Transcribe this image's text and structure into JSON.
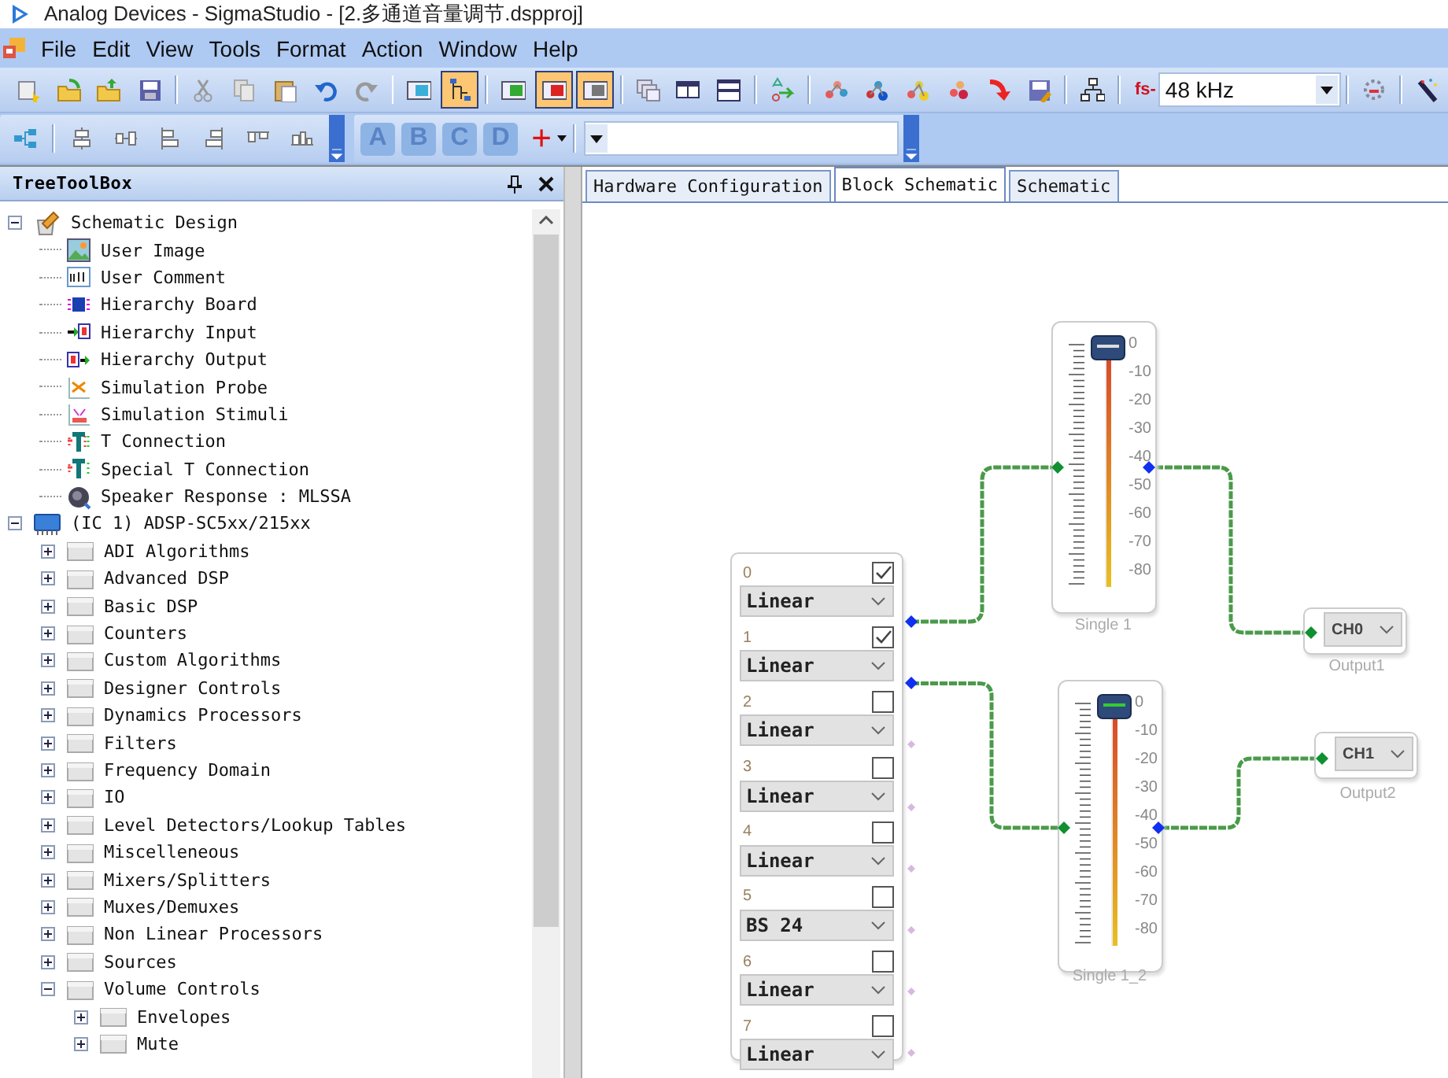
{
  "window": {
    "title": "Analog Devices - SigmaStudio - [2.多通道音量调节.dspproj]"
  },
  "menu": [
    "File",
    "Edit",
    "View",
    "Tools",
    "Format",
    "Action",
    "Window",
    "Help"
  ],
  "toolbar": {
    "buttons": [
      {
        "pressed": false
      },
      {
        "pressed": false
      },
      {
        "pressed": false
      },
      {
        "pressed": false
      },
      {
        "pressed": false
      },
      {
        "pressed": false
      },
      {
        "pressed": false
      },
      {
        "pressed": false
      },
      {
        "pressed": false
      },
      {
        "pressed": false
      },
      {
        "pressed": true
      },
      {
        "pressed": false
      },
      {
        "pressed": true
      },
      {
        "pressed": true
      },
      {
        "pressed": false
      },
      {
        "pressed": false
      },
      {
        "pressed": false
      },
      {
        "pressed": false
      },
      {
        "pressed": false
      },
      {
        "pressed": false
      },
      {
        "pressed": false
      },
      {
        "pressed": false
      },
      {
        "pressed": false
      },
      {
        "pressed": false
      },
      {
        "pressed": false
      }
    ],
    "fs_label": "fs-",
    "sample_rate": "48 kHz"
  },
  "toolbar2": {
    "letters": [
      "A",
      "B",
      "C",
      "D"
    ],
    "add": "+"
  },
  "panel": {
    "title": "TreeToolBox",
    "tree": [
      {
        "label": "Schematic Design",
        "kind": "design",
        "expanded": true,
        "children": [
          {
            "label": "User Image",
            "kind": "tool"
          },
          {
            "label": "User Comment",
            "kind": "tool"
          },
          {
            "label": "Hierarchy Board",
            "kind": "tool"
          },
          {
            "label": "Hierarchy Input",
            "kind": "tool"
          },
          {
            "label": "Hierarchy Output",
            "kind": "tool"
          },
          {
            "label": "Simulation Probe",
            "kind": "tool"
          },
          {
            "label": "Simulation Stimuli",
            "kind": "tool"
          },
          {
            "label": "T Connection",
            "kind": "tool"
          },
          {
            "label": "Special T Connection",
            "kind": "tool"
          },
          {
            "label": "Speaker Response : MLSSA",
            "kind": "tool"
          }
        ]
      },
      {
        "label": "(IC 1) ADSP-SC5xx/215xx",
        "kind": "chip",
        "expanded": true,
        "children": [
          {
            "label": "ADI Algorithms",
            "kind": "folder",
            "expanded": false
          },
          {
            "label": "Advanced DSP",
            "kind": "folder",
            "expanded": false
          },
          {
            "label": "Basic DSP",
            "kind": "folder",
            "expanded": false
          },
          {
            "label": "Counters",
            "kind": "folder",
            "expanded": false
          },
          {
            "label": "Custom Algorithms",
            "kind": "folder",
            "expanded": false
          },
          {
            "label": "Designer Controls",
            "kind": "folder",
            "expanded": false
          },
          {
            "label": "Dynamics Processors",
            "kind": "folder",
            "expanded": false
          },
          {
            "label": "Filters",
            "kind": "folder",
            "expanded": false
          },
          {
            "label": "Frequency Domain",
            "kind": "folder",
            "expanded": false
          },
          {
            "label": "IO",
            "kind": "folder",
            "expanded": false
          },
          {
            "label": "Level Detectors/Lookup Tables",
            "kind": "folder",
            "expanded": false
          },
          {
            "label": "Miscelleneous",
            "kind": "folder",
            "expanded": false
          },
          {
            "label": "Mixers/Splitters",
            "kind": "folder",
            "expanded": false
          },
          {
            "label": "Muxes/Demuxes",
            "kind": "folder",
            "expanded": false
          },
          {
            "label": "Non Linear Processors",
            "kind": "folder",
            "expanded": false
          },
          {
            "label": "Sources",
            "kind": "folder",
            "expanded": false
          },
          {
            "label": "Volume Controls",
            "kind": "folder",
            "expanded": true,
            "children": [
              {
                "label": "Envelopes",
                "kind": "folder",
                "expanded": false
              },
              {
                "label": "Mute",
                "kind": "folder",
                "expanded": false
              }
            ]
          }
        ]
      }
    ]
  },
  "tabs": [
    {
      "label": "Hardware Configuration",
      "selected": false
    },
    {
      "label": "Block Schematic",
      "selected": true
    },
    {
      "label": "Schematic",
      "selected": false
    }
  ],
  "input": {
    "channels": [
      {
        "label": "0",
        "checked": true,
        "mode": "Linear",
        "connected": true
      },
      {
        "label": "1",
        "checked": true,
        "mode": "Linear",
        "connected": true
      },
      {
        "label": "2",
        "checked": false,
        "mode": "Linear",
        "connected": false
      },
      {
        "label": "3",
        "checked": false,
        "mode": "Linear",
        "connected": false
      },
      {
        "label": "4",
        "checked": false,
        "mode": "Linear",
        "connected": false
      },
      {
        "label": "5",
        "checked": false,
        "mode": "BS 24",
        "connected": false
      },
      {
        "label": "6",
        "checked": false,
        "mode": "Linear",
        "connected": false
      },
      {
        "label": "7",
        "checked": false,
        "mode": "Linear",
        "connected": false
      }
    ]
  },
  "sliders": [
    {
      "name": "Single 1",
      "level": 1,
      "scale": [
        "0",
        "-10",
        "-20",
        "-30",
        "-40",
        "-50",
        "-60",
        "-70",
        "-80"
      ]
    },
    {
      "name": "Single 1_2",
      "level": 1,
      "scale": [
        "0",
        "-10",
        "-20",
        "-30",
        "-40",
        "-50",
        "-60",
        "-70",
        "-80"
      ]
    }
  ],
  "outputs": [
    {
      "channel": "CH0",
      "name": "Output1"
    },
    {
      "channel": "CH1",
      "name": "Output2"
    }
  ]
}
